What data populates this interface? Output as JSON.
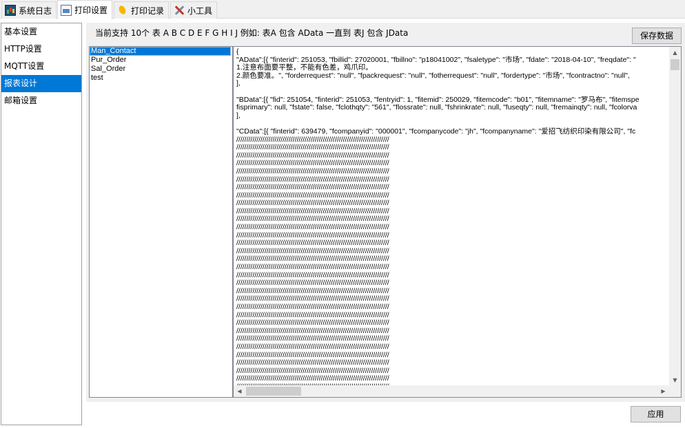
{
  "tabs": [
    {
      "label": "系统日志",
      "icon": "log-icon"
    },
    {
      "label": "打印设置",
      "icon": "print-settings-icon"
    },
    {
      "label": "打印记录",
      "icon": "print-record-icon"
    },
    {
      "label": "小工具",
      "icon": "tools-icon"
    }
  ],
  "sidebar": {
    "items": [
      {
        "label": "基本设置"
      },
      {
        "label": "HTTP设置"
      },
      {
        "label": "MQTT设置"
      },
      {
        "label": "报表设计",
        "selected": true
      },
      {
        "label": "邮箱设置"
      }
    ]
  },
  "main": {
    "hint": "当前支持 10个 表 A B C D E F G H I J 例如: 表A 包含 AData 一直到 表J 包含 JData",
    "save_label": "保存数据",
    "apply_label": "应用",
    "reports": [
      {
        "label": "Man_Contact",
        "selected": true
      },
      {
        "label": "Pur_Order"
      },
      {
        "label": "Sal_Order"
      },
      {
        "label": "test"
      }
    ],
    "editor_lines": [
      "{",
      "\"AData\":[{ \"finterid\": 251053, \"fbillid\": 27020001, \"fbillno\": \"p18041002\", \"fsaletype\": \"市场\", \"fdate\": \"2018-04-10\", \"freqdate\": \"",
      "1.注意布面要平整，不能有色差，鸡爪印。",
      "2.颜色要准。\", \"forderrequest\": \"null\", \"fpackrequest\": \"null\", \"fotherrequest\": \"null\", \"fordertype\": \"市场\", \"fcontractno\": \"null\",",
      "],",
      "",
      "\"BData\":[{ \"fid\": 251054, \"finterid\": 251053, \"fentryid\": 1, \"fitemid\": 250029, \"fitemcode\": \"b01\", \"fitemname\": \"罗马布\", \"fitemspe",
      "fisprimary\": null, \"fstate\": false, \"fclothqty\": \"561\", \"flossrate\": null, \"fshrinkrate\": null, \"fuseqty\": null, \"fremainqty\": null, \"fcolorva",
      "],",
      "",
      "\"CData\":[{ \"finterid\": 639479, \"fcompanyid\": \"000001\", \"fcompanycode\": \"jh\", \"fcompanyname\": \"爱招飞纺织印染有限公司\", \"fc",
      "////////////////////////////////////////////////////////////////////////////",
      "////////////////////////////////////////////////////////////////////////////",
      "////////////////////////////////////////////////////////////////////////////",
      "////////////////////////////////////////////////////////////////////////////",
      "////////////////////////////////////////////////////////////////////////////",
      "////////////////////////////////////////////////////////////////////////////",
      "////////////////////////////////////////////////////////////////////////////",
      "////////////////////////////////////////////////////////////////////////////",
      "////////////////////////////////////////////////////////////////////////////",
      "////////////////////////////////////////////////////////////////////////////",
      "////////////////////////////////////////////////////////////////////////////",
      "////////////////////////////////////////////////////////////////////////////",
      "////////////////////////////////////////////////////////////////////////////",
      "////////////////////////////////////////////////////////////////////////////",
      "////////////////////////////////////////////////////////////////////////////",
      "////////////////////////////////////////////////////////////////////////////",
      "////////////////////////////////////////////////////////////////////////////",
      "////////////////////////////////////////////////////////////////////////////",
      "////////////////////////////////////////////////////////////////////////////",
      "////////////////////////////////////////////////////////////////////////////",
      "////////////////////////////////////////////////////////////////////////////",
      "////////////////////////////////////////////////////////////////////////////",
      "////////////////////////////////////////////////////////////////////////////",
      "////////////////////////////////////////////////////////////////////////////",
      "////////////////////////////////////////////////////////////////////////////",
      "////////////////////////////////////////////////////////////////////////////",
      "////////////////////////////////////////////////////////////////////////////",
      "////////////////////////////////////////////////////////////////////////////",
      "////////////////////////////////////////////////////////////////////////////",
      "////////////////////////////////////////////////////////////////////////////",
      "////////////////////////////////////////////////////////////////////////////",
      "////////////////////////////////////////////////////////////////////////////",
      "////////////////////////////////////////////////////////////////////////////",
      "////////////////////////////////////////////////////////////////////////////"
    ]
  },
  "colors": {
    "selection": "#0078d7",
    "window_bg": "#f0f0f0",
    "button_bg": "#e1e1e1"
  }
}
